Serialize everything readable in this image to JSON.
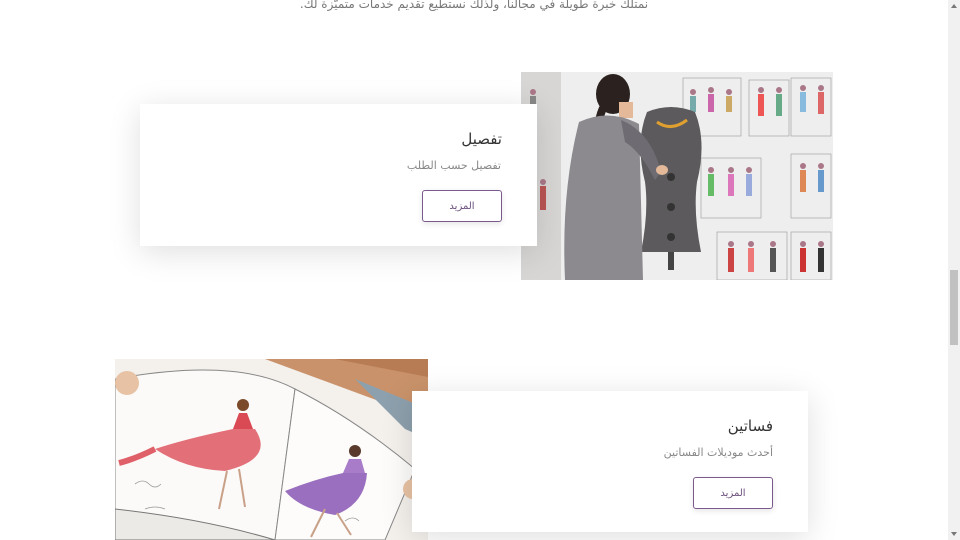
{
  "intro": {
    "text": "نمتلك خبرة طويلة في مجالنا، ولذلك نستطيع تقديم خدمات متميّزة لك."
  },
  "services": [
    {
      "title": "تفصيل",
      "subtitle": "تفصيل حسب الطلب",
      "button_label": "المزيد",
      "image": "tailoring-photo"
    },
    {
      "title": "فساتين",
      "subtitle": "أحدث موديلات الفساتين",
      "button_label": "المزيد",
      "image": "dress-sketchbook-illustration"
    }
  ],
  "colors": {
    "button_border": "#7a5a8c",
    "button_text": "#6b4f7d"
  }
}
